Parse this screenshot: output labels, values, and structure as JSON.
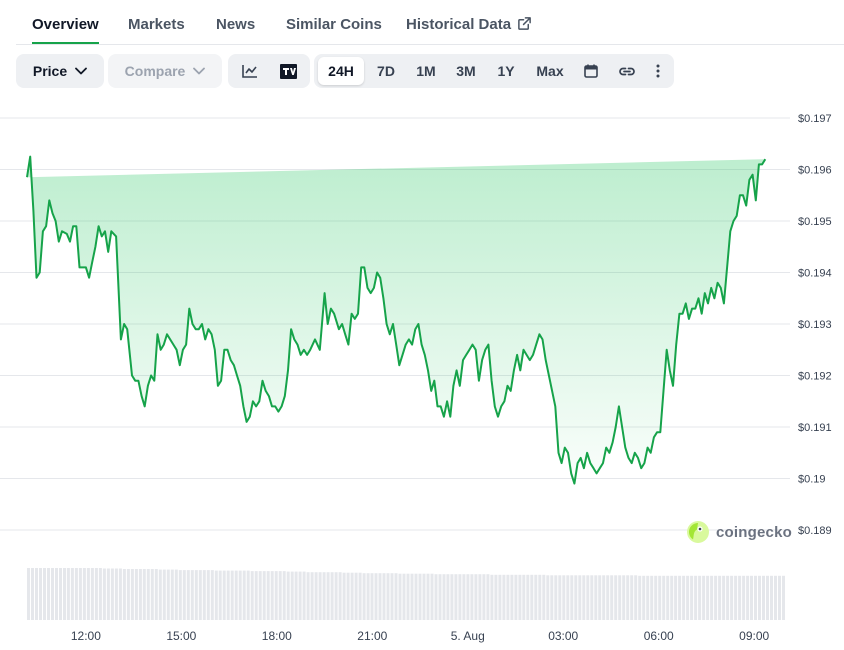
{
  "tabs": [
    {
      "label": "Overview",
      "active": true
    },
    {
      "label": "Markets",
      "active": false
    },
    {
      "label": "News",
      "active": false
    },
    {
      "label": "Similar Coins",
      "active": false
    },
    {
      "label": "Historical Data",
      "active": false,
      "icon": "external-link-icon"
    }
  ],
  "toolbar": {
    "price_label": "Price",
    "compare_label": "Compare",
    "view_icons": [
      "line-chart-icon",
      "tradingview-icon"
    ],
    "ranges": [
      "24H",
      "7D",
      "1M",
      "3M",
      "1Y",
      "Max"
    ],
    "active_range": "24H",
    "extra_icons": [
      "calendar-icon",
      "link-icon",
      "more-icon"
    ]
  },
  "watermark": "coingecko",
  "colors": {
    "line": "#16a34a",
    "fill": "#22c55e",
    "volume": "#e5e7eb",
    "accent": "#16a34a"
  },
  "chart_data": {
    "type": "area",
    "y_ticks": [
      "$0.197",
      "$0.196",
      "$0.195",
      "$0.194",
      "$0.193",
      "$0.192",
      "$0.191",
      "$0.19",
      "$0.189"
    ],
    "ylim": [
      0.189,
      0.197
    ],
    "x_ticks": [
      "12:00",
      "15:00",
      "18:00",
      "21:00",
      "5. Aug",
      "03:00",
      "06:00",
      "09:00"
    ],
    "x_tick_hours": [
      12,
      15,
      18,
      21,
      24,
      27,
      30,
      33
    ],
    "xlim_hours": [
      10.15,
      34.0
    ],
    "grid": true,
    "series": [
      {
        "x_hours": [
          10.15,
          10.25,
          10.35,
          10.45,
          10.55,
          10.65,
          10.75,
          10.85,
          10.95,
          11.05,
          11.15,
          11.25,
          11.4,
          11.5,
          11.6,
          11.7,
          11.8,
          12.0,
          12.1,
          12.2,
          12.3,
          12.4,
          12.5,
          12.6,
          12.7,
          12.8,
          12.95,
          13.1,
          13.2,
          13.3,
          13.45,
          13.55,
          13.65,
          13.75,
          13.85,
          13.95,
          14.05,
          14.15,
          14.25,
          14.35,
          14.45,
          14.55,
          14.75,
          14.85,
          14.95,
          15.05,
          15.15,
          15.25,
          15.35,
          15.45,
          15.55,
          15.65,
          15.75,
          15.85,
          15.95,
          16.05,
          16.15,
          16.25,
          16.35,
          16.45,
          16.55,
          16.65,
          16.75,
          16.85,
          16.95,
          17.05,
          17.15,
          17.25,
          17.35,
          17.45,
          17.55,
          17.65,
          17.75,
          17.85,
          17.95,
          18.05,
          18.15,
          18.25,
          18.35,
          18.45,
          18.55,
          18.65,
          18.75,
          18.85,
          18.95,
          19.05,
          19.2,
          19.35,
          19.5,
          19.6,
          19.7,
          19.8,
          19.95,
          20.05,
          20.15,
          20.25,
          20.35,
          20.45,
          20.55,
          20.65,
          20.75,
          20.85,
          20.95,
          21.05,
          21.15,
          21.25,
          21.35,
          21.45,
          21.55,
          21.65,
          21.75,
          21.85,
          21.95,
          22.05,
          22.15,
          22.25,
          22.35,
          22.45,
          22.55,
          22.65,
          22.75,
          22.85,
          22.95,
          23.05,
          23.15,
          23.25,
          23.35,
          23.45,
          23.55,
          23.65,
          23.75,
          23.85,
          23.95,
          24.05,
          24.15,
          24.25,
          24.35,
          24.45,
          24.55,
          24.65,
          24.75,
          24.85,
          24.95,
          25.05,
          25.15,
          25.25,
          25.35,
          25.45,
          25.55,
          25.65,
          25.75,
          25.85,
          25.95,
          26.05,
          26.15,
          26.25,
          26.35,
          26.45,
          26.55,
          26.65,
          26.75,
          26.85,
          26.95,
          27.05,
          27.15,
          27.25,
          27.35,
          27.45,
          27.55,
          27.65,
          27.75,
          27.85,
          27.95,
          28.05,
          28.15,
          28.25,
          28.35,
          28.45,
          28.55,
          28.65,
          28.75,
          28.85,
          28.95,
          29.05,
          29.15,
          29.25,
          29.35,
          29.45,
          29.55,
          29.65,
          29.75,
          29.85,
          29.95,
          30.05,
          30.15,
          30.25,
          30.35,
          30.45,
          30.55,
          30.65,
          30.75,
          30.85,
          30.95,
          31.05,
          31.15,
          31.25,
          31.35,
          31.45,
          31.55,
          31.65,
          31.75,
          31.85,
          31.95,
          32.05,
          32.15,
          32.25,
          32.35,
          32.45,
          32.55,
          32.65,
          32.75,
          32.85,
          32.95,
          33.05,
          33.15,
          33.25,
          33.35,
          33.45,
          33.55,
          33.65,
          33.75,
          33.85,
          33.95,
          34.0
        ],
        "values": [
          0.19585,
          0.19625,
          0.1952,
          0.1939,
          0.194,
          0.1948,
          0.1949,
          0.1954,
          0.19515,
          0.195,
          0.1946,
          0.1948,
          0.19475,
          0.1946,
          0.1949,
          0.1949,
          0.1941,
          0.1941,
          0.1939,
          0.1942,
          0.1945,
          0.1949,
          0.1947,
          0.1948,
          0.1944,
          0.1948,
          0.1947,
          0.1927,
          0.193,
          0.1929,
          0.192,
          0.1919,
          0.1919,
          0.1916,
          0.1914,
          0.1918,
          0.192,
          0.1919,
          0.1928,
          0.1925,
          0.1926,
          0.1928,
          0.1926,
          0.1925,
          0.1922,
          0.1925,
          0.1926,
          0.1933,
          0.193,
          0.1929,
          0.1929,
          0.193,
          0.1927,
          0.1929,
          0.1928,
          0.1925,
          0.1918,
          0.1919,
          0.1925,
          0.1925,
          0.1923,
          0.1922,
          0.192,
          0.1918,
          0.1914,
          0.1911,
          0.1912,
          0.1915,
          0.1914,
          0.1915,
          0.1919,
          0.1917,
          0.1916,
          0.1914,
          0.1914,
          0.1913,
          0.1914,
          0.1916,
          0.1921,
          0.1929,
          0.1927,
          0.1926,
          0.1924,
          0.1925,
          0.1924,
          0.1925,
          0.1927,
          0.1925,
          0.1936,
          0.193,
          0.1933,
          0.1932,
          0.1929,
          0.193,
          0.1928,
          0.1926,
          0.1932,
          0.1931,
          0.1932,
          0.1941,
          0.1941,
          0.1937,
          0.1936,
          0.1937,
          0.194,
          0.1939,
          0.1935,
          0.193,
          0.1928,
          0.193,
          0.1926,
          0.1922,
          0.1924,
          0.1926,
          0.1927,
          0.1926,
          0.1929,
          0.193,
          0.1926,
          0.1924,
          0.1921,
          0.1917,
          0.1919,
          0.1914,
          0.1914,
          0.1912,
          0.1915,
          0.1912,
          0.1918,
          0.1921,
          0.1918,
          0.1923,
          0.1924,
          0.1925,
          0.1926,
          0.1925,
          0.1919,
          0.1923,
          0.1925,
          0.1926,
          0.1919,
          0.1914,
          0.1912,
          0.1914,
          0.1915,
          0.1918,
          0.1917,
          0.1921,
          0.1924,
          0.1921,
          0.1925,
          0.1924,
          0.1923,
          0.1924,
          0.1926,
          0.1928,
          0.1927,
          0.1923,
          0.192,
          0.1917,
          0.1914,
          0.1905,
          0.1903,
          0.1906,
          0.1905,
          0.1901,
          0.1899,
          0.1903,
          0.1904,
          0.1902,
          0.1905,
          0.1903,
          0.1902,
          0.1901,
          0.1902,
          0.1903,
          0.1906,
          0.1905,
          0.1907,
          0.191,
          0.1914,
          0.191,
          0.1906,
          0.1904,
          0.1903,
          0.1905,
          0.1904,
          0.1902,
          0.1903,
          0.1906,
          0.1905,
          0.1908,
          0.1909,
          0.1909,
          0.1917,
          0.1925,
          0.1921,
          0.1918,
          0.1926,
          0.1932,
          0.1932,
          0.1934,
          0.1931,
          0.1933,
          0.1933,
          0.1935,
          0.1932,
          0.1936,
          0.1934,
          0.1937,
          0.1935,
          0.1938,
          0.1937,
          0.1934,
          0.1941,
          0.1948,
          0.195,
          0.1951,
          0.1955,
          0.1955,
          0.1953,
          0.1958,
          0.1959,
          0.1954,
          0.1961,
          0.1961,
          0.1962
        ],
        "volume_levels": [
          1.0,
          1.0,
          1.0,
          1.0,
          0.99,
          0.98,
          0.98,
          0.97,
          0.96,
          0.96,
          0.95,
          0.95,
          0.94,
          0.94,
          0.93,
          0.92,
          0.92,
          0.91,
          0.9,
          0.9,
          0.89,
          0.89,
          0.88,
          0.88,
          0.88,
          0.87,
          0.87,
          0.87,
          0.86,
          0.86,
          0.86,
          0.86,
          0.86,
          0.85,
          0.85,
          0.85,
          0.85,
          0.85,
          0.85,
          0.85,
          0.85
        ]
      }
    ]
  }
}
